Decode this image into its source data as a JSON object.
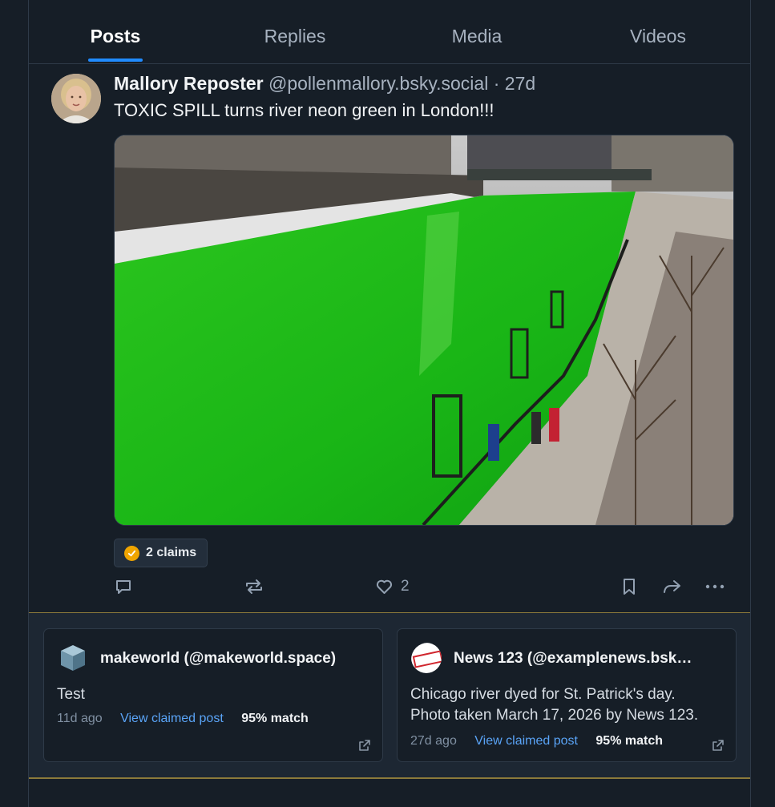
{
  "tabs": [
    {
      "label": "Posts",
      "active": true
    },
    {
      "label": "Replies",
      "active": false
    },
    {
      "label": "Media",
      "active": false
    },
    {
      "label": "Videos",
      "active": false
    }
  ],
  "post": {
    "author_name": "Mallory Reposter",
    "author_handle": "@pollenmallory.bsky.social",
    "separator": "·",
    "time": "27d",
    "text": "TOXIC SPILL turns river neon green in London!!!",
    "image_description_icon": "photo",
    "claims_label": "2 claims",
    "like_count": "2"
  },
  "actions": {
    "reply_icon": "reply-icon",
    "repost_icon": "repost-icon",
    "like_icon": "heart-icon",
    "bookmark_icon": "bookmark-icon",
    "share_icon": "share-icon",
    "more_icon": "more-icon"
  },
  "claims": [
    {
      "title": "makeworld (@makeworld.space)",
      "text_lines": [
        "Test"
      ],
      "ago": "11d ago",
      "link": "View claimed post",
      "match": "95% match"
    },
    {
      "title": "News 123 (@examplenews.bsky…",
      "text_lines": [
        "Chicago river dyed for St. Patrick's day.",
        "Photo taken March 17, 2026 by News 123."
      ],
      "ago": "27d ago",
      "link": "View claimed post",
      "match": "95% match",
      "logo_text": "NEWS"
    }
  ],
  "colors": {
    "accent": "#208bfe",
    "link": "#5aa4f7",
    "claim_badge": "#f0a500",
    "panel_border": "#8c7a3a"
  }
}
